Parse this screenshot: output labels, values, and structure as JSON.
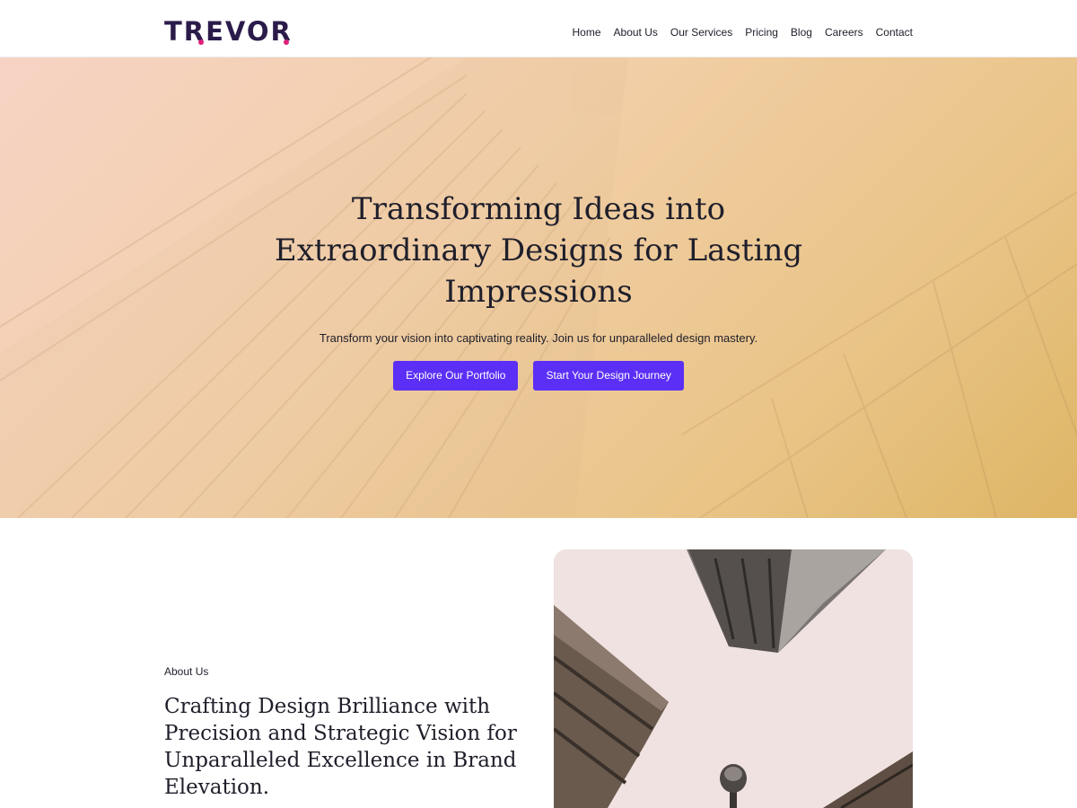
{
  "brand": {
    "name": "TREVOR",
    "accent": "#5b2ff5",
    "logo_color": "#2b1b4a",
    "logo_dot_color": "#e0207a"
  },
  "nav": {
    "items": [
      {
        "label": "Home"
      },
      {
        "label": "About Us"
      },
      {
        "label": "Our Services"
      },
      {
        "label": "Pricing"
      },
      {
        "label": "Blog"
      },
      {
        "label": "Careers"
      },
      {
        "label": "Contact"
      }
    ]
  },
  "hero": {
    "title": "Transforming Ideas into Extraordinary Designs for Lasting Impressions",
    "subtitle": "Transform your vision into captivating reality. Join us for unparalleled design mastery.",
    "primary_button": "Explore Our Portfolio",
    "secondary_button": "Start Your Design Journey",
    "background_image": "skyscraper-photo"
  },
  "about": {
    "label": "About Us",
    "title": "Crafting Design Brilliance with Precision and Strategic Vision for Unparalleled Excellence in Brand Elevation.",
    "image": "buildings-photo"
  }
}
